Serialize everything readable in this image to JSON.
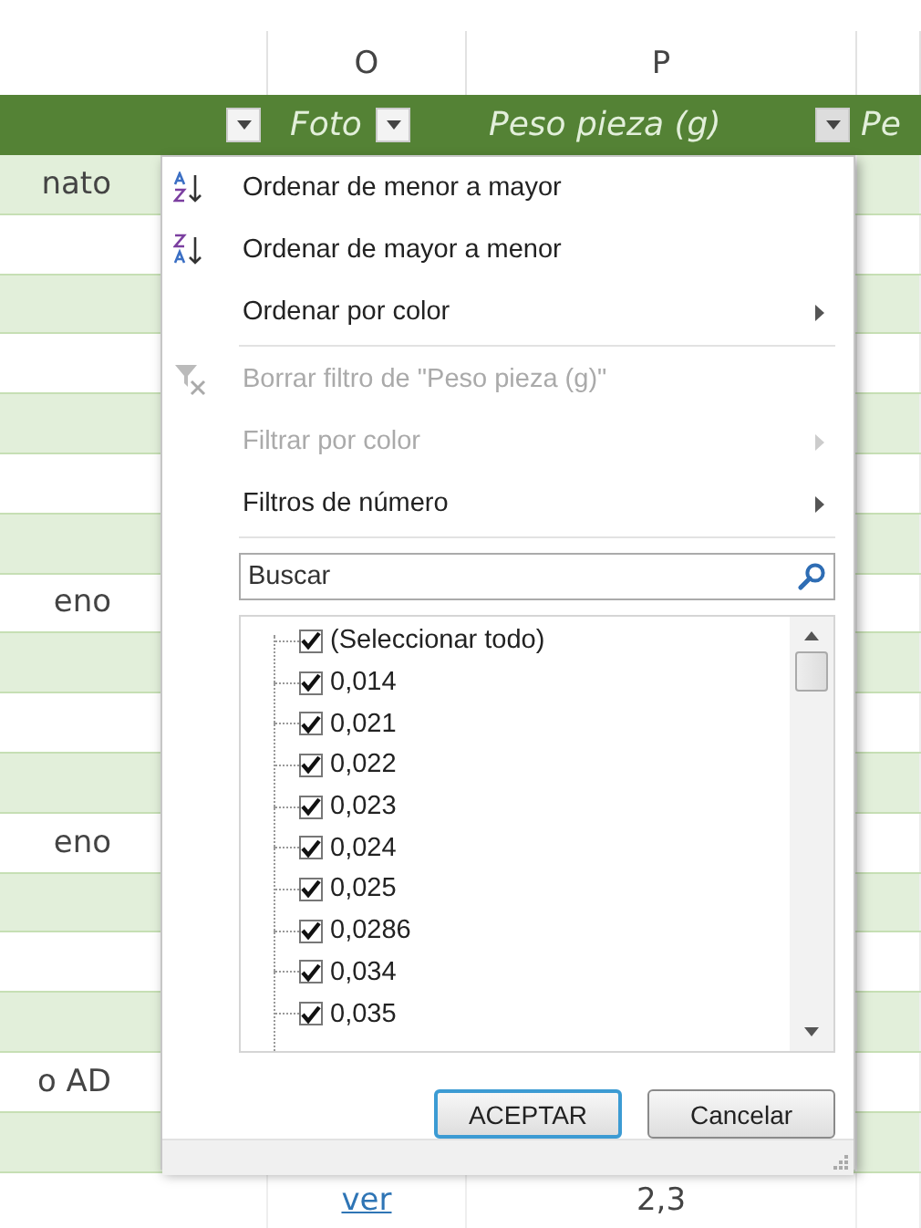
{
  "column_headers": [
    {
      "letter": "O"
    },
    {
      "letter": "P"
    }
  ],
  "header_row": {
    "cells": [
      {
        "text": "Foto"
      },
      {
        "text": "Peso pieza (g)"
      },
      {
        "text": "Pe"
      }
    ]
  },
  "rows": [
    {
      "column_1": "nato"
    },
    {},
    {},
    {},
    {},
    {},
    {},
    {
      "column_1": "eno"
    },
    {},
    {},
    {},
    {
      "column_1": "eno"
    },
    {},
    {},
    {},
    {
      "column_1": "o AD"
    },
    {},
    {
      "column_o": "ver",
      "column_p": "2,3"
    }
  ],
  "menu": {
    "sections": [
      [
        {
          "kind": "sort-asc",
          "label": "Ordenar de menor a mayor",
          "disabled": false
        },
        {
          "kind": "sort-desc",
          "label": "Ordenar de mayor a menor",
          "disabled": false
        },
        {
          "kind": "submenu",
          "label": "Ordenar por color",
          "disabled": false
        }
      ],
      [
        {
          "kind": "clear-filter",
          "label": "Borrar filtro de \"Peso pieza (g)\"",
          "disabled": true
        },
        {
          "kind": "submenu",
          "label": "Filtrar por color",
          "disabled": true
        },
        {
          "kind": "submenu",
          "label": "Filtros de número",
          "disabled": false
        }
      ]
    ],
    "search": {
      "placeholder": "Buscar"
    },
    "values": [
      {
        "label": "(Seleccionar todo)",
        "checked": true
      },
      {
        "label": "0,014",
        "checked": true
      },
      {
        "label": "0,021",
        "checked": true
      },
      {
        "label": "0,022",
        "checked": true
      },
      {
        "label": "0,023",
        "checked": true
      },
      {
        "label": "0,024",
        "checked": true
      },
      {
        "label": "0,025",
        "checked": true
      },
      {
        "label": "0,0286",
        "checked": true
      },
      {
        "label": "0,034",
        "checked": true
      },
      {
        "label": "0,035",
        "checked": true
      }
    ],
    "buttons": [
      {
        "label": "ACEPTAR",
        "default": true
      },
      {
        "label": "Cancelar",
        "default": false
      }
    ]
  }
}
